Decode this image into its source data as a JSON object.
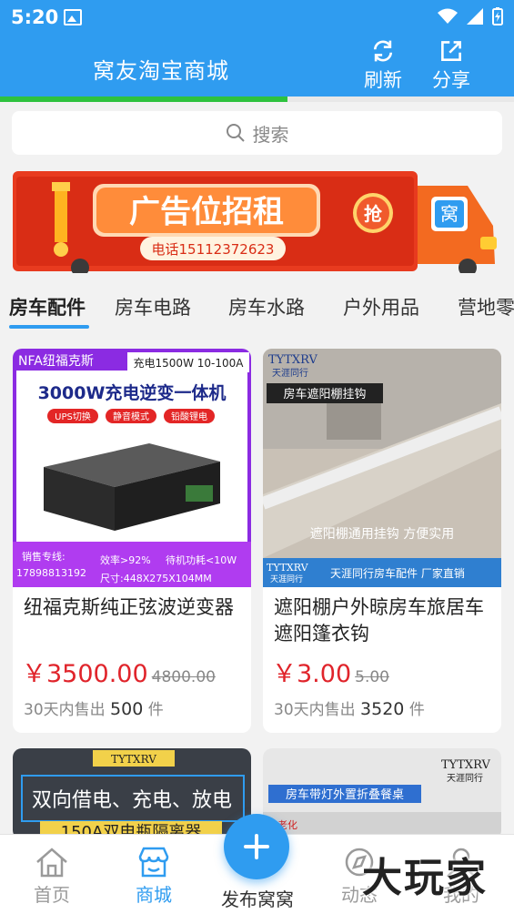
{
  "status_bar": {
    "time": "5:20"
  },
  "header": {
    "title": "窝友淘宝商城",
    "refresh_label": "刷新",
    "share_label": "分享",
    "color": "#2f9cf0"
  },
  "page_load_progress": 0.56,
  "search": {
    "placeholder": "搜索"
  },
  "banner": {
    "headline": "广告位招租",
    "phone": "电话15112372623",
    "badge": "抢",
    "logo_char": "窝"
  },
  "tabs": [
    {
      "label": "房车配件",
      "active": true
    },
    {
      "label": "房车电路",
      "active": false
    },
    {
      "label": "房车水路",
      "active": false
    },
    {
      "label": "户外用品",
      "active": false
    },
    {
      "label": "营地零",
      "active": false
    }
  ],
  "products": [
    {
      "name": "纽福克斯纯正弦波逆变器",
      "price": "￥3500.00",
      "old_price": "4800.00",
      "sold_prefix": "30天内售出",
      "sold_count": "500",
      "sold_unit": "件",
      "image": {
        "brand": "NFA纽福克斯",
        "spec": "充电1500W 10-100A",
        "title": "3000W充电逆变一体机",
        "tags": [
          "UPS切换",
          "静音模式",
          "铅酸锂电"
        ],
        "hotline_label": "销售专线:",
        "hotline": "17898813192",
        "efficiency": "效率>92%",
        "standby": "待机功耗<10W",
        "size": "尺寸:448X275X104MM"
      }
    },
    {
      "name": "遮阳棚户外晾房车旅居车遮阳篷衣钩",
      "price": "￥3.00",
      "old_price": "5.00",
      "sold_prefix": "30天内售出",
      "sold_count": "3520",
      "sold_unit": "件",
      "image": {
        "brand": "TYTXRV",
        "brand_sub": "天涯同行",
        "tag": "房车遮阳棚挂钩",
        "caption": "遮阳棚通用挂钩  方便实用",
        "footer": "天涯同行房车配件 厂家直销"
      }
    },
    {
      "image": {
        "brand": "TYTXRV",
        "title": "双向借电、充电、放电",
        "subtitle": "150A双电瓶隔离器"
      }
    },
    {
      "image": {
        "brand": "TYTXRV",
        "brand_sub": "天涯同行",
        "tag": "房车带灯外置折叠餐桌",
        "note": "老化"
      }
    }
  ],
  "bottom_nav": {
    "home": "首页",
    "mall": "商城",
    "publish": "发布窝窝",
    "feed": "动态",
    "mine": "我的"
  },
  "watermark": "大玩家"
}
